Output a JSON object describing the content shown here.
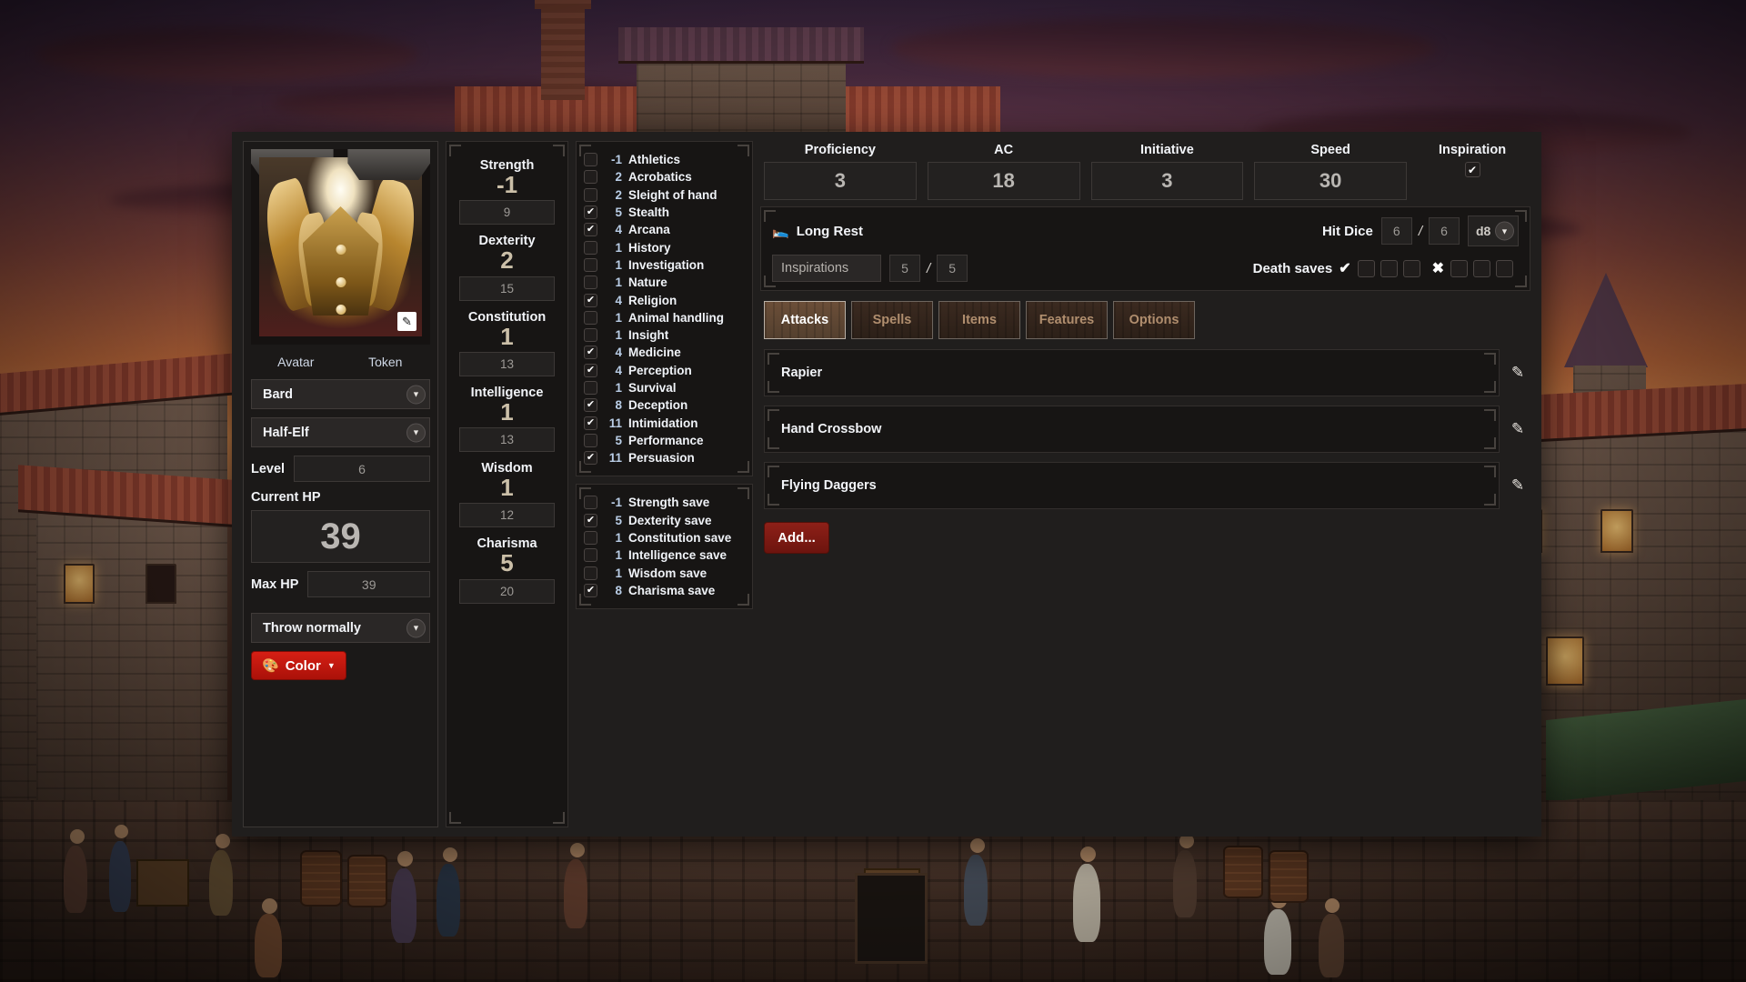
{
  "portrait": {
    "avatar_tab": "Avatar",
    "token_tab": "Token",
    "edit_icon": "edit-pencil-icon"
  },
  "identity": {
    "class_value": "Bard",
    "race_value": "Half-Elf",
    "level_label": "Level",
    "level_value": "6",
    "current_hp_label": "Current HP",
    "current_hp_value": "39",
    "max_hp_label": "Max HP",
    "max_hp_value": "39",
    "throw_mode_value": "Throw normally",
    "color_button_label": "Color",
    "color_button_hex": "#d61f14",
    "palette_icon": "palette-icon"
  },
  "abilities": [
    {
      "name": "Strength",
      "modifier": "-1",
      "score": "9"
    },
    {
      "name": "Dexterity",
      "modifier": "2",
      "score": "15"
    },
    {
      "name": "Constitution",
      "modifier": "1",
      "score": "13"
    },
    {
      "name": "Intelligence",
      "modifier": "1",
      "score": "13"
    },
    {
      "name": "Wisdom",
      "modifier": "1",
      "score": "12"
    },
    {
      "name": "Charisma",
      "modifier": "5",
      "score": "20"
    }
  ],
  "skills": [
    {
      "value": "-1",
      "name": "Athletics",
      "proficient": false
    },
    {
      "value": "2",
      "name": "Acrobatics",
      "proficient": false
    },
    {
      "value": "2",
      "name": "Sleight of hand",
      "proficient": false
    },
    {
      "value": "5",
      "name": "Stealth",
      "proficient": true
    },
    {
      "value": "4",
      "name": "Arcana",
      "proficient": true
    },
    {
      "value": "1",
      "name": "History",
      "proficient": false
    },
    {
      "value": "1",
      "name": "Investigation",
      "proficient": false
    },
    {
      "value": "1",
      "name": "Nature",
      "proficient": false
    },
    {
      "value": "4",
      "name": "Religion",
      "proficient": true
    },
    {
      "value": "1",
      "name": "Animal handling",
      "proficient": false
    },
    {
      "value": "1",
      "name": "Insight",
      "proficient": false
    },
    {
      "value": "4",
      "name": "Medicine",
      "proficient": true
    },
    {
      "value": "4",
      "name": "Perception",
      "proficient": true
    },
    {
      "value": "1",
      "name": "Survival",
      "proficient": false
    },
    {
      "value": "8",
      "name": "Deception",
      "proficient": true
    },
    {
      "value": "11",
      "name": "Intimidation",
      "proficient": true
    },
    {
      "value": "5",
      "name": "Performance",
      "proficient": false
    },
    {
      "value": "11",
      "name": "Persuasion",
      "proficient": true
    }
  ],
  "saves": [
    {
      "value": "-1",
      "name": "Strength save",
      "proficient": false
    },
    {
      "value": "5",
      "name": "Dexterity save",
      "proficient": true
    },
    {
      "value": "1",
      "name": "Constitution save",
      "proficient": false
    },
    {
      "value": "1",
      "name": "Intelligence save",
      "proficient": false
    },
    {
      "value": "1",
      "name": "Wisdom save",
      "proficient": false
    },
    {
      "value": "8",
      "name": "Charisma save",
      "proficient": true
    }
  ],
  "top_stats": [
    {
      "name": "Proficiency",
      "value": "3"
    },
    {
      "name": "AC",
      "value": "18"
    },
    {
      "name": "Initiative",
      "value": "3"
    },
    {
      "name": "Speed",
      "value": "30"
    }
  ],
  "inspiration": {
    "label": "Inspiration",
    "checked": true
  },
  "rest": {
    "long_rest_label": "Long Rest",
    "bed_icon": "bed-icon",
    "hit_dice_label": "Hit Dice",
    "hit_dice_current": "6",
    "hit_dice_max": "6",
    "hit_dice_type": "d8",
    "inspirations_label": "Inspirations",
    "inspirations_current": "5",
    "inspirations_max": "5",
    "death_saves_label": "Death saves",
    "death_success_icon": "check-icon",
    "death_failure_icon": "cross-icon",
    "death_success_boxes": 3,
    "death_failure_boxes": 3
  },
  "tabs": [
    {
      "label": "Attacks",
      "active": true
    },
    {
      "label": "Spells",
      "active": false
    },
    {
      "label": "Items",
      "active": false
    },
    {
      "label": "Features",
      "active": false
    },
    {
      "label": "Options",
      "active": false
    }
  ],
  "attacks": [
    {
      "name": "Rapier"
    },
    {
      "name": "Hand Crossbow"
    },
    {
      "name": "Flying Daggers"
    }
  ],
  "add_button_label": "Add..."
}
